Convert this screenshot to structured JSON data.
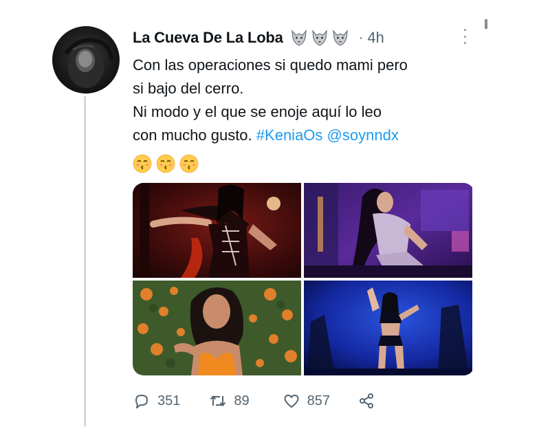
{
  "tweet": {
    "display_name": "La Cueva De La Loba",
    "badge_icons": [
      "wolf-icon",
      "wolf-icon",
      "wolf-icon"
    ],
    "separator": "·",
    "timestamp": "4h",
    "text_lines": [
      "Con las operaciones si quedo mami pero",
      "si bajo del cerro."
    ],
    "text_line3": "Ni modo y el que se enoje aquí  lo leo",
    "text_line4_plain": "con mucho gusto.",
    "hashtag": "#KeniaOs",
    "mention": "@soynndx",
    "emojis": [
      "kissing-face-icon",
      "kissing-face-icon",
      "kissing-face-icon"
    ],
    "media": [
      {
        "name": "photo-performer-red-stage"
      },
      {
        "name": "photo-performer-purple-stage"
      },
      {
        "name": "photo-woman-orange-flowers"
      },
      {
        "name": "photo-performer-blue-stage"
      }
    ]
  },
  "actions": {
    "replies": "351",
    "retweets": "89",
    "likes": "857"
  },
  "colors": {
    "link": "#1d9bf0",
    "secondary": "#536471",
    "thread_line": "#cfd9de"
  }
}
